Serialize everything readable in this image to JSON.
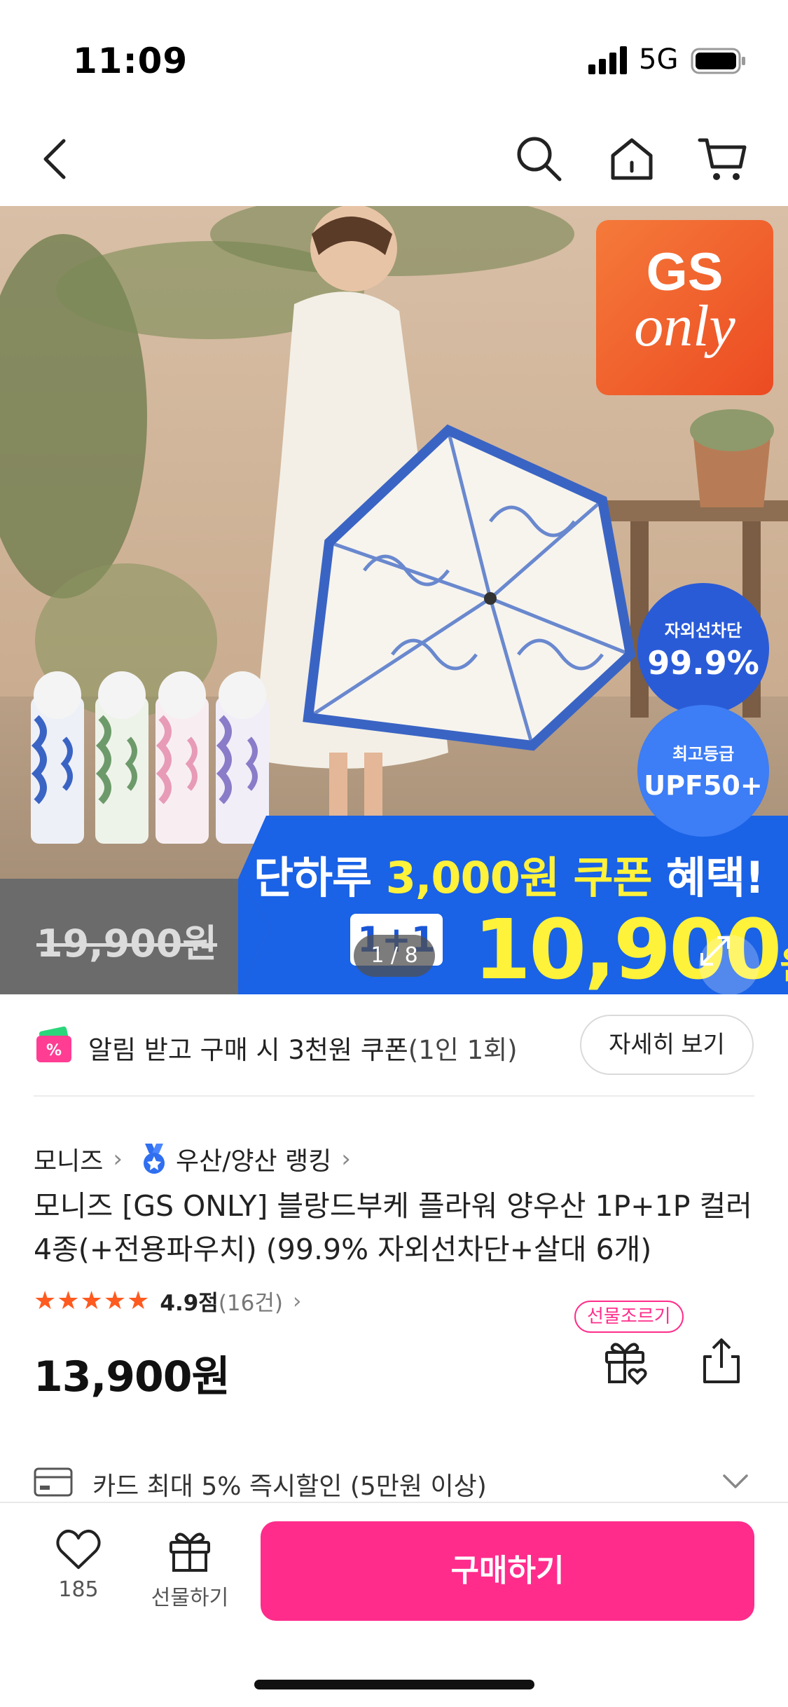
{
  "status_bar": {
    "time": "11:09",
    "network": "5G"
  },
  "nav": {
    "back": "back-arrow-icon",
    "search": "search-icon",
    "home": "home-icon",
    "cart": "cart-icon"
  },
  "hero": {
    "badge_gs": "GS",
    "badge_only": "only",
    "uv_label": "자외선차단",
    "uv_value": "99.9%",
    "upf_label": "최고등급",
    "upf_value": "UPF50+",
    "promo_prefix": "단하루 ",
    "promo_highlight": "3,000원 쿠폰",
    "promo_suffix": " 혜택!",
    "old_price": "19,900원",
    "plus_tag": "1+1",
    "sale_price": "10,900",
    "sale_unit": "원",
    "page_indicator": "1 / 8"
  },
  "coupon": {
    "text": "알림 받고 구매 시 3천원 쿠폰",
    "sub": "(1인 1회)",
    "detail_button": "자세히 보기"
  },
  "product": {
    "brand": "모니즈",
    "ranking": "우산/양산 랭킹",
    "title": "모니즈 [GS ONLY] 블랑드부케 플라워 양우산 1P+1P 컬러 4종(+전용파우치) (99.9% 자외선차단+살대 6개)",
    "stars": "★★★★★",
    "rating": "4.9점",
    "review_count": "(16건)",
    "price": "13,900원",
    "gift_request_tag": "선물조르기"
  },
  "card_benefit": {
    "text": "카드 최대 5% 즉시할인 (5만원 이상)"
  },
  "bottom_bar": {
    "like_count": "185",
    "gift_label": "선물하기",
    "buy_label": "구매하기"
  },
  "colors": {
    "accent": "#ff2c8c",
    "star": "#ff5a1f",
    "banner_blue": "#1a62e6",
    "promo_yellow": "#fff23a"
  }
}
